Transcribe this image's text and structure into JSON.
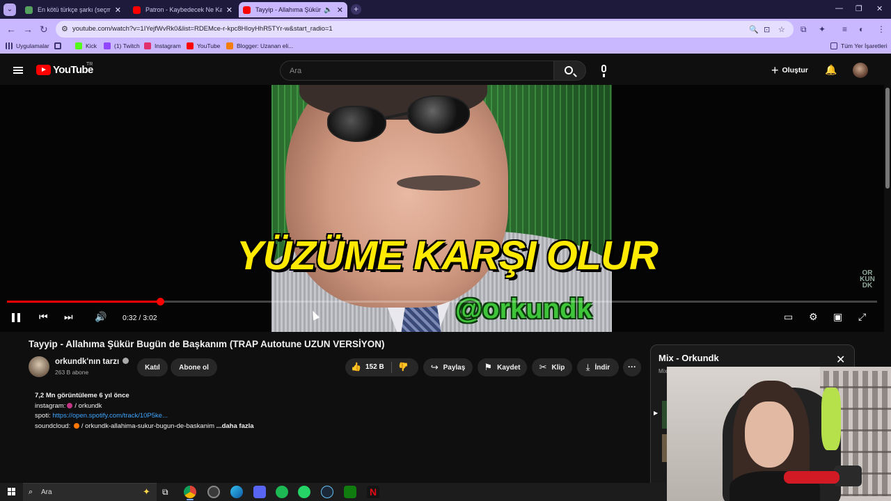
{
  "browser": {
    "tabs": [
      {
        "title": "En kötü türkçe şarkı (seçmek çok zor)",
        "favicon_color": "#55a05e",
        "active": false
      },
      {
        "title": "Patron - Kaybedecek Ne Kaldı",
        "favicon_color": "#ff0000",
        "active": false
      },
      {
        "title": "Tayyip - Allahıma Şükür Bugün de Başkanım",
        "favicon_color": "#ff0000",
        "active": true,
        "audio_icon": "speaker-icon"
      }
    ],
    "url": "youtube.com/watch?v=1IYejfWvRk0&list=RDEMce-r-kpc8HIoyHhR5TYr-w&start_radio=1",
    "bookmarks": [
      {
        "label": "Uygulamalar",
        "icon": "apps-grid-icon",
        "color": "#3c3470"
      },
      {
        "label": "",
        "icon": "grid-icon",
        "color": "#3c3470"
      },
      {
        "label": "Kick",
        "icon": "kick-icon",
        "color": "#53fc18"
      },
      {
        "label": "(1) Twitch",
        "icon": "twitch-icon",
        "color": "#9146ff"
      },
      {
        "label": "Instagram",
        "icon": "instagram-icon",
        "color": "#e1306c"
      },
      {
        "label": "YouTube",
        "icon": "youtube-icon",
        "color": "#ff0000"
      },
      {
        "label": "Blogger: Uzanan eli...",
        "icon": "blogger-icon",
        "color": "#f57d00"
      }
    ],
    "all_bookmarks_label": "Tüm Yer İşaretleri"
  },
  "youtube": {
    "logo_text": "YouTube",
    "region": "TR",
    "search_placeholder": "Ara",
    "create_label": "Oluştur"
  },
  "player": {
    "caption_text": "YÜZÜME KARŞI OLUR",
    "handle_text": "@orkundk",
    "watermark_text": "OR KUN DK",
    "current_time": "0:32",
    "duration": "3:02",
    "time_display": "0:32 / 3:02",
    "progress_fraction": 0.1758,
    "accent_color": "#ff0000"
  },
  "video": {
    "title": "Tayyip - Allahıma Şükür Bugün de Başkanım (TRAP Autotune UZUN VERSİYON)",
    "channel_name": "orkundk'nın tarzı",
    "subscribers": "263 B abone",
    "join_label": "Katıl",
    "subscribe_label": "Abone ol",
    "likes": "152 B",
    "share_label": "Paylaş",
    "save_label": "Kaydet",
    "clip_label": "Klip",
    "download_label": "İndir"
  },
  "description": {
    "meta": "7,2 Mn görüntüleme  6 yıl önce",
    "instagram_label": "instagram:",
    "instagram_value": "/ orkundk",
    "spotify_label": "spoti:",
    "spotify_link": "https://open.spotify.com/track/10P5ke...",
    "soundcloud_label": "soundcloud:",
    "soundcloud_value": "/ orkundk-allahima-sukur-bugun-de-baskanim",
    "more_label": "...daha fazla"
  },
  "mix": {
    "title": "Mix - Orkundk",
    "subtitle": "Mix"
  },
  "taskbar": {
    "search_placeholder": "Ara"
  }
}
